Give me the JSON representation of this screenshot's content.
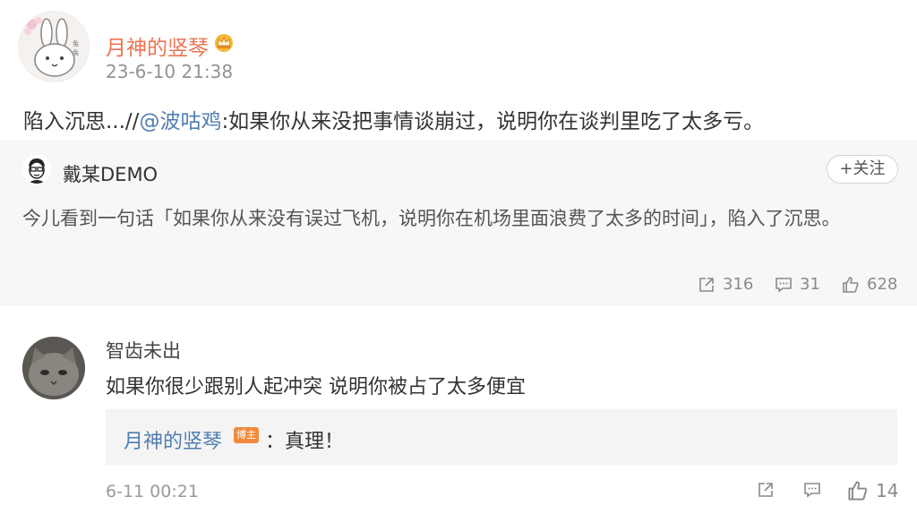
{
  "post": {
    "author": "月神的竖琴",
    "timestamp": "23-6-10 21:38",
    "text_prefix": "陷入沉思...//",
    "mention": "@波咕鸡",
    "text_suffix": ":如果你从来没把事情谈崩过，说明你在谈判里吃了太多亏。",
    "avatar_icon": "bunny-avatar-icon",
    "vip_icon": "crown-icon"
  },
  "repost": {
    "author": "戴某DEMO",
    "follow_label": "+关注",
    "text": "今儿看到一句话「如果你从来没有误过飞机，说明你在机场里面浪费了太多的时间」，陷入了沉思。",
    "actions": {
      "share_count": "316",
      "comment_count": "31",
      "like_count": "628"
    }
  },
  "comment": {
    "author": "智齿未出",
    "text": "如果你很少跟别人起冲突 说明你被占了太多便宜",
    "reply": {
      "author": "月神的竖琴",
      "badge": "博主",
      "text": "：真理！"
    },
    "time": "6-11 00:21",
    "like_count": "14"
  },
  "colors": {
    "author_orange": "#eb7350",
    "link_blue": "#507daf",
    "badge_orange": "#f28a3c"
  }
}
